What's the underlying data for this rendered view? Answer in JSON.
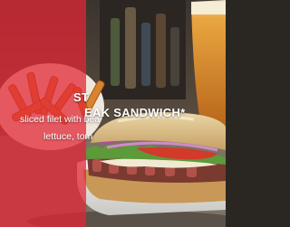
{
  "slide": {
    "title_part1": "ST",
    "title_part2": "EAK SANDWICH*",
    "description_line1": "sliced filet with bea",
    "description_line2": "lettuce, tom"
  },
  "colors": {
    "overlay_red": "#e22634",
    "text": "#ffffff"
  },
  "image": {
    "subject": "steak-sandwich-with-fries-and-beer"
  }
}
